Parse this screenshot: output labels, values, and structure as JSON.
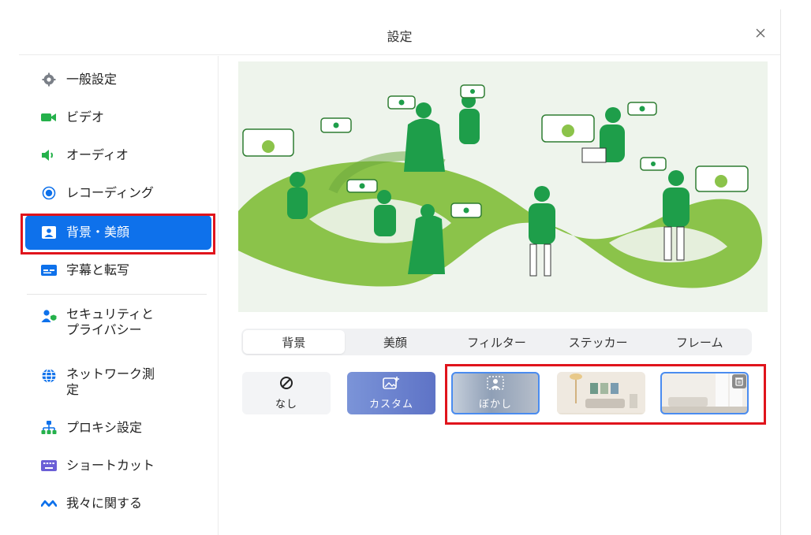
{
  "window": {
    "title": "設定"
  },
  "sidebar": {
    "items": [
      {
        "label": "一般設定",
        "icon": "gear-icon"
      },
      {
        "label": "ビデオ",
        "icon": "video-camera-icon"
      },
      {
        "label": "オーディオ",
        "icon": "speaker-icon"
      },
      {
        "label": "レコーディング",
        "icon": "record-icon"
      },
      {
        "label": "背景・美顔",
        "icon": "portrait-icon",
        "active": true
      },
      {
        "label": "字幕と転写",
        "icon": "caption-icon"
      },
      {
        "label_lines": [
          "セキュリティと",
          "プライバシー"
        ],
        "icon": "shield-user-icon"
      },
      {
        "label_lines": [
          "ネットワーク測",
          "定"
        ],
        "icon": "globe-icon"
      },
      {
        "label": "プロキシ設定",
        "icon": "network-tree-icon"
      },
      {
        "label": "ショートカット",
        "icon": "keyboard-icon"
      },
      {
        "label": "我々に関する",
        "icon": "brand-wave-icon"
      }
    ]
  },
  "main": {
    "tabs": [
      {
        "label": "背景",
        "active": true
      },
      {
        "label": "美顔"
      },
      {
        "label": "フィルター"
      },
      {
        "label": "ステッカー"
      },
      {
        "label": "フレーム"
      }
    ],
    "backgrounds": [
      {
        "label": "なし",
        "icon": "no-entry-icon"
      },
      {
        "label": "カスタム",
        "icon": "add-image-icon"
      },
      {
        "label": "ぼかし",
        "icon": "blur-person-icon",
        "selected": true
      },
      {
        "label": "",
        "icon": "living-room-thumbnail"
      },
      {
        "label": "",
        "icon": "white-room-thumbnail",
        "selected": true
      }
    ]
  },
  "colors": {
    "accent": "#0e71eb",
    "highlight_frame": "#e0141c",
    "illustration_green": "#8bc34a",
    "illustration_dark_green": "#1e9e4a"
  }
}
